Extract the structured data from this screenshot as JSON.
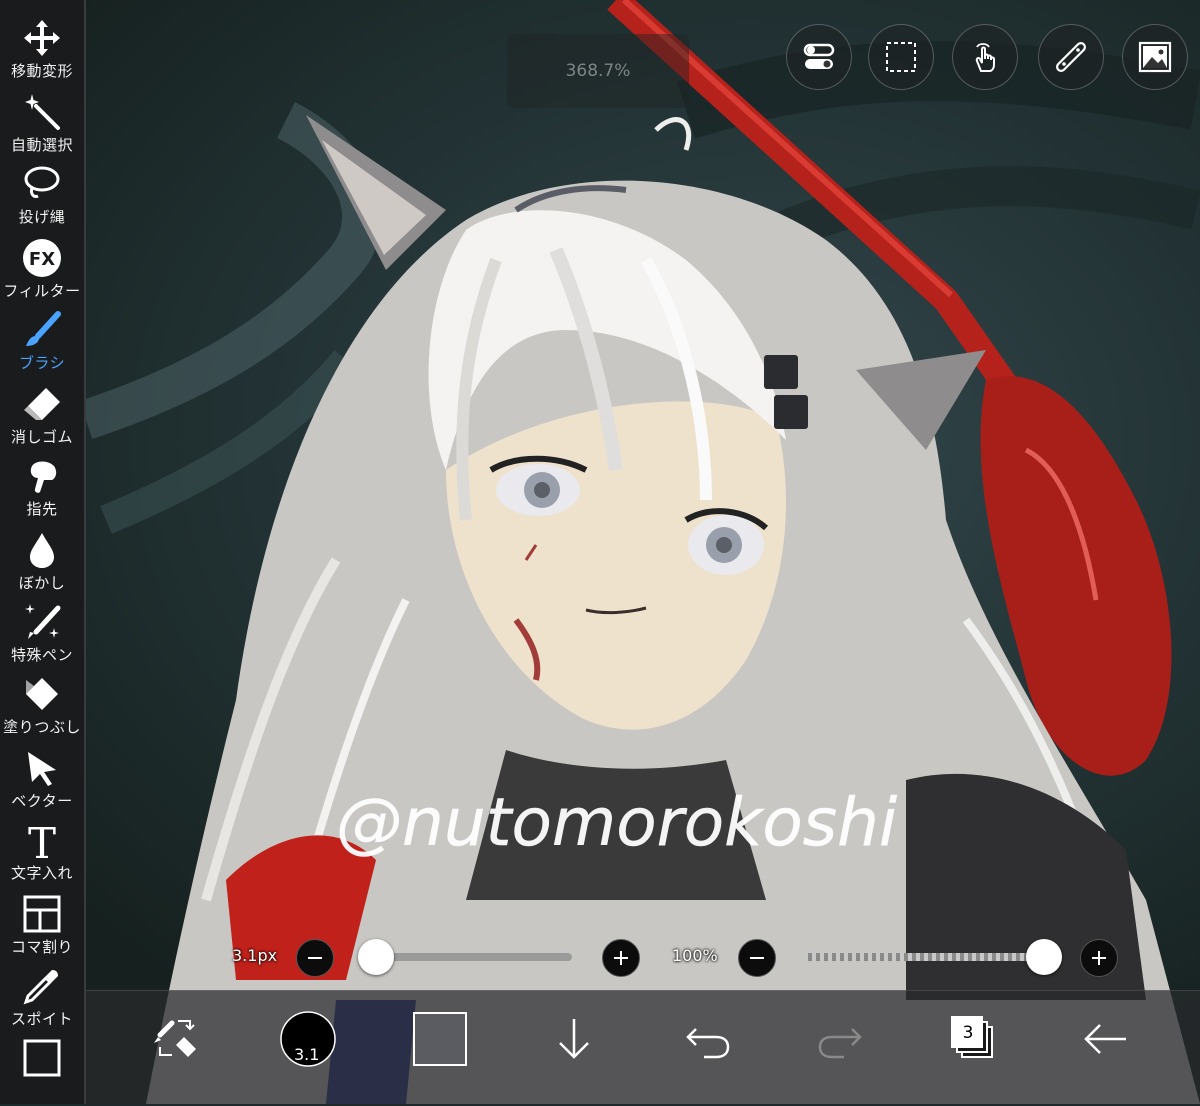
{
  "toolbar": {
    "items": [
      {
        "label": "移動変形",
        "icon": "move-arrows-icon"
      },
      {
        "label": "自動選択",
        "icon": "magic-wand-icon"
      },
      {
        "label": "投げ縄",
        "icon": "lasso-icon"
      },
      {
        "label": "フィルター",
        "icon": "fx-icon"
      },
      {
        "label": "ブラシ",
        "icon": "brush-icon"
      },
      {
        "label": "消しゴム",
        "icon": "eraser-icon"
      },
      {
        "label": "指先",
        "icon": "finger-icon"
      },
      {
        "label": "ぼかし",
        "icon": "blur-drop-icon"
      },
      {
        "label": "特殊ペン",
        "icon": "special-pen-icon"
      },
      {
        "label": "塗りつぶし",
        "icon": "bucket-icon"
      },
      {
        "label": "ベクター",
        "icon": "vector-arrow-icon"
      },
      {
        "label": "文字入れ",
        "icon": "text-icon"
      },
      {
        "label": "コマ割り",
        "icon": "frame-divide-icon"
      },
      {
        "label": "スポイト",
        "icon": "eyedropper-icon"
      }
    ],
    "active_index": 4
  },
  "zoom": {
    "text": "368.7%"
  },
  "sliders": {
    "brush_size": {
      "label": "3.1px",
      "value": 0.0
    },
    "opacity": {
      "label": "100%",
      "value": 1.0
    }
  },
  "bottom": {
    "brush_size_badge": "3.1",
    "layer_count": "3"
  },
  "canvas": {
    "watermark": "@nutomorokoshi"
  },
  "colors": {
    "accent": "#4aa3ff",
    "toolbar_bg": "#1a1b1d",
    "secondary_color": "#5b5c62",
    "primary_color": "#000000"
  }
}
